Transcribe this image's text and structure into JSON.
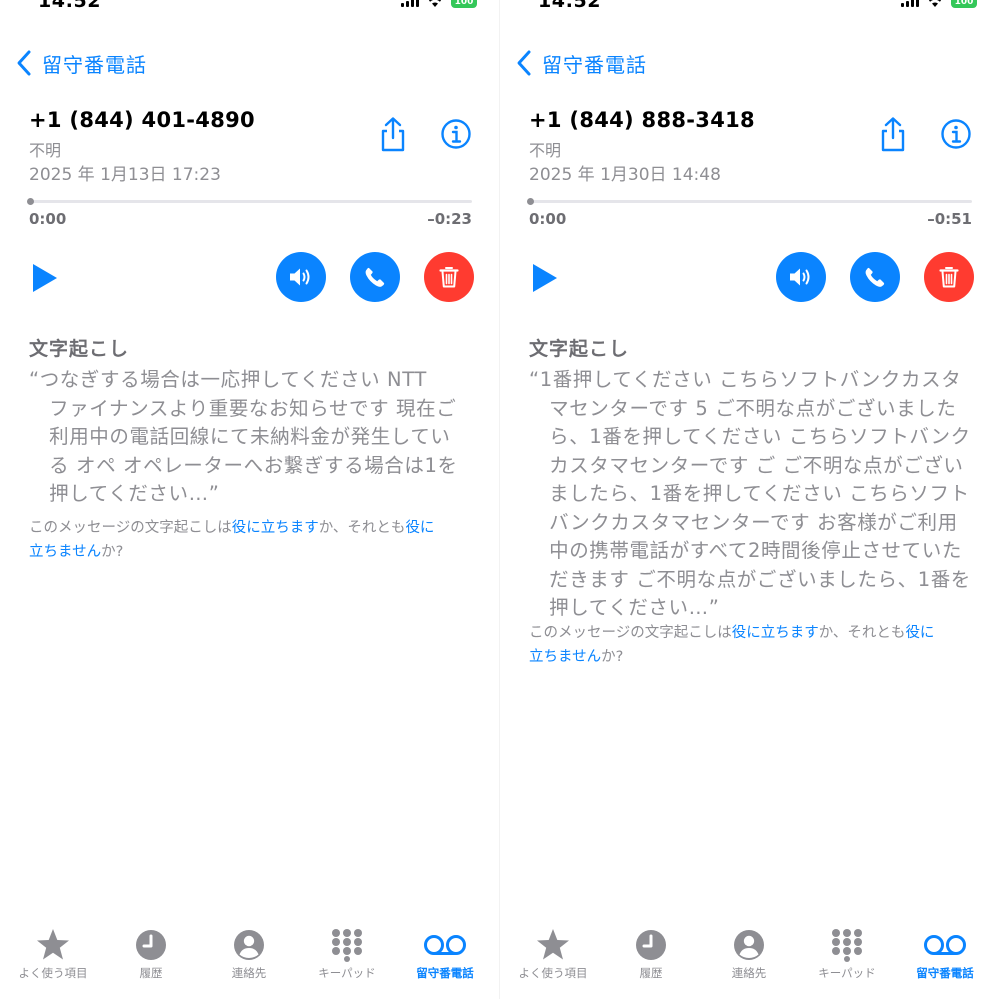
{
  "colors": {
    "accent": "#0a84ff",
    "delete": "#ff3b30",
    "battery": "#34c759",
    "secondary_text": "#8e8e93"
  },
  "shared": {
    "status_time": "14:52",
    "battery": "100",
    "back_label": "留守番電話",
    "time_start": "0:00",
    "transcript_title": "文字起こし",
    "feedback": {
      "prefix": "このメッセージの文字起こしは",
      "helpful": "役に立ちます",
      "middle": "か、それとも",
      "not_helpful_1": "役に",
      "not_helpful_2": "立ちません",
      "suffix": "か?"
    },
    "tabs": [
      {
        "label": "よく使う項目",
        "icon": "star-icon"
      },
      {
        "label": "履歴",
        "icon": "clock-icon"
      },
      {
        "label": "連絡先",
        "icon": "person-icon"
      },
      {
        "label": "キーパッド",
        "icon": "keypad-icon"
      },
      {
        "label": "留守番電話",
        "icon": "voicemail-icon",
        "active": true
      }
    ]
  },
  "left": {
    "number": "+1 (844) 401-4890",
    "type": "不明",
    "date": "2025 年 1月13日 17:23",
    "time_remaining": "–0:23",
    "transcript_lines": [
      "“つなぎする場合は一応押してください NTT",
      "　ファイナンスより重要なお知らせです 現在ご",
      "　利用中の電話回線にて未納料金が発生してい",
      "　る オペ オペレーターへお繋ぎする場合は1を",
      "　押してください…”"
    ]
  },
  "right": {
    "number": "+1 (844) 888-3418",
    "type": "不明",
    "date": "2025 年 1月30日 14:48",
    "time_remaining": "–0:51",
    "transcript_lines": [
      "“1番押してください こちらソフトバンクカスタ",
      "　マセンターです 5 ご不明な点がございました",
      "　ら、1番を押してください こちらソフトバンク",
      "　カスタマセンターです ご ご不明な点がござい",
      "　ましたら、1番を押してください こちらソフト",
      "　バンクカスタマセンターです お客様がご利用",
      "　中の携帯電話がすべて2時間後停止させていた",
      "　だきます ご不明な点がございましたら、1番を",
      "　押してください…”"
    ]
  }
}
